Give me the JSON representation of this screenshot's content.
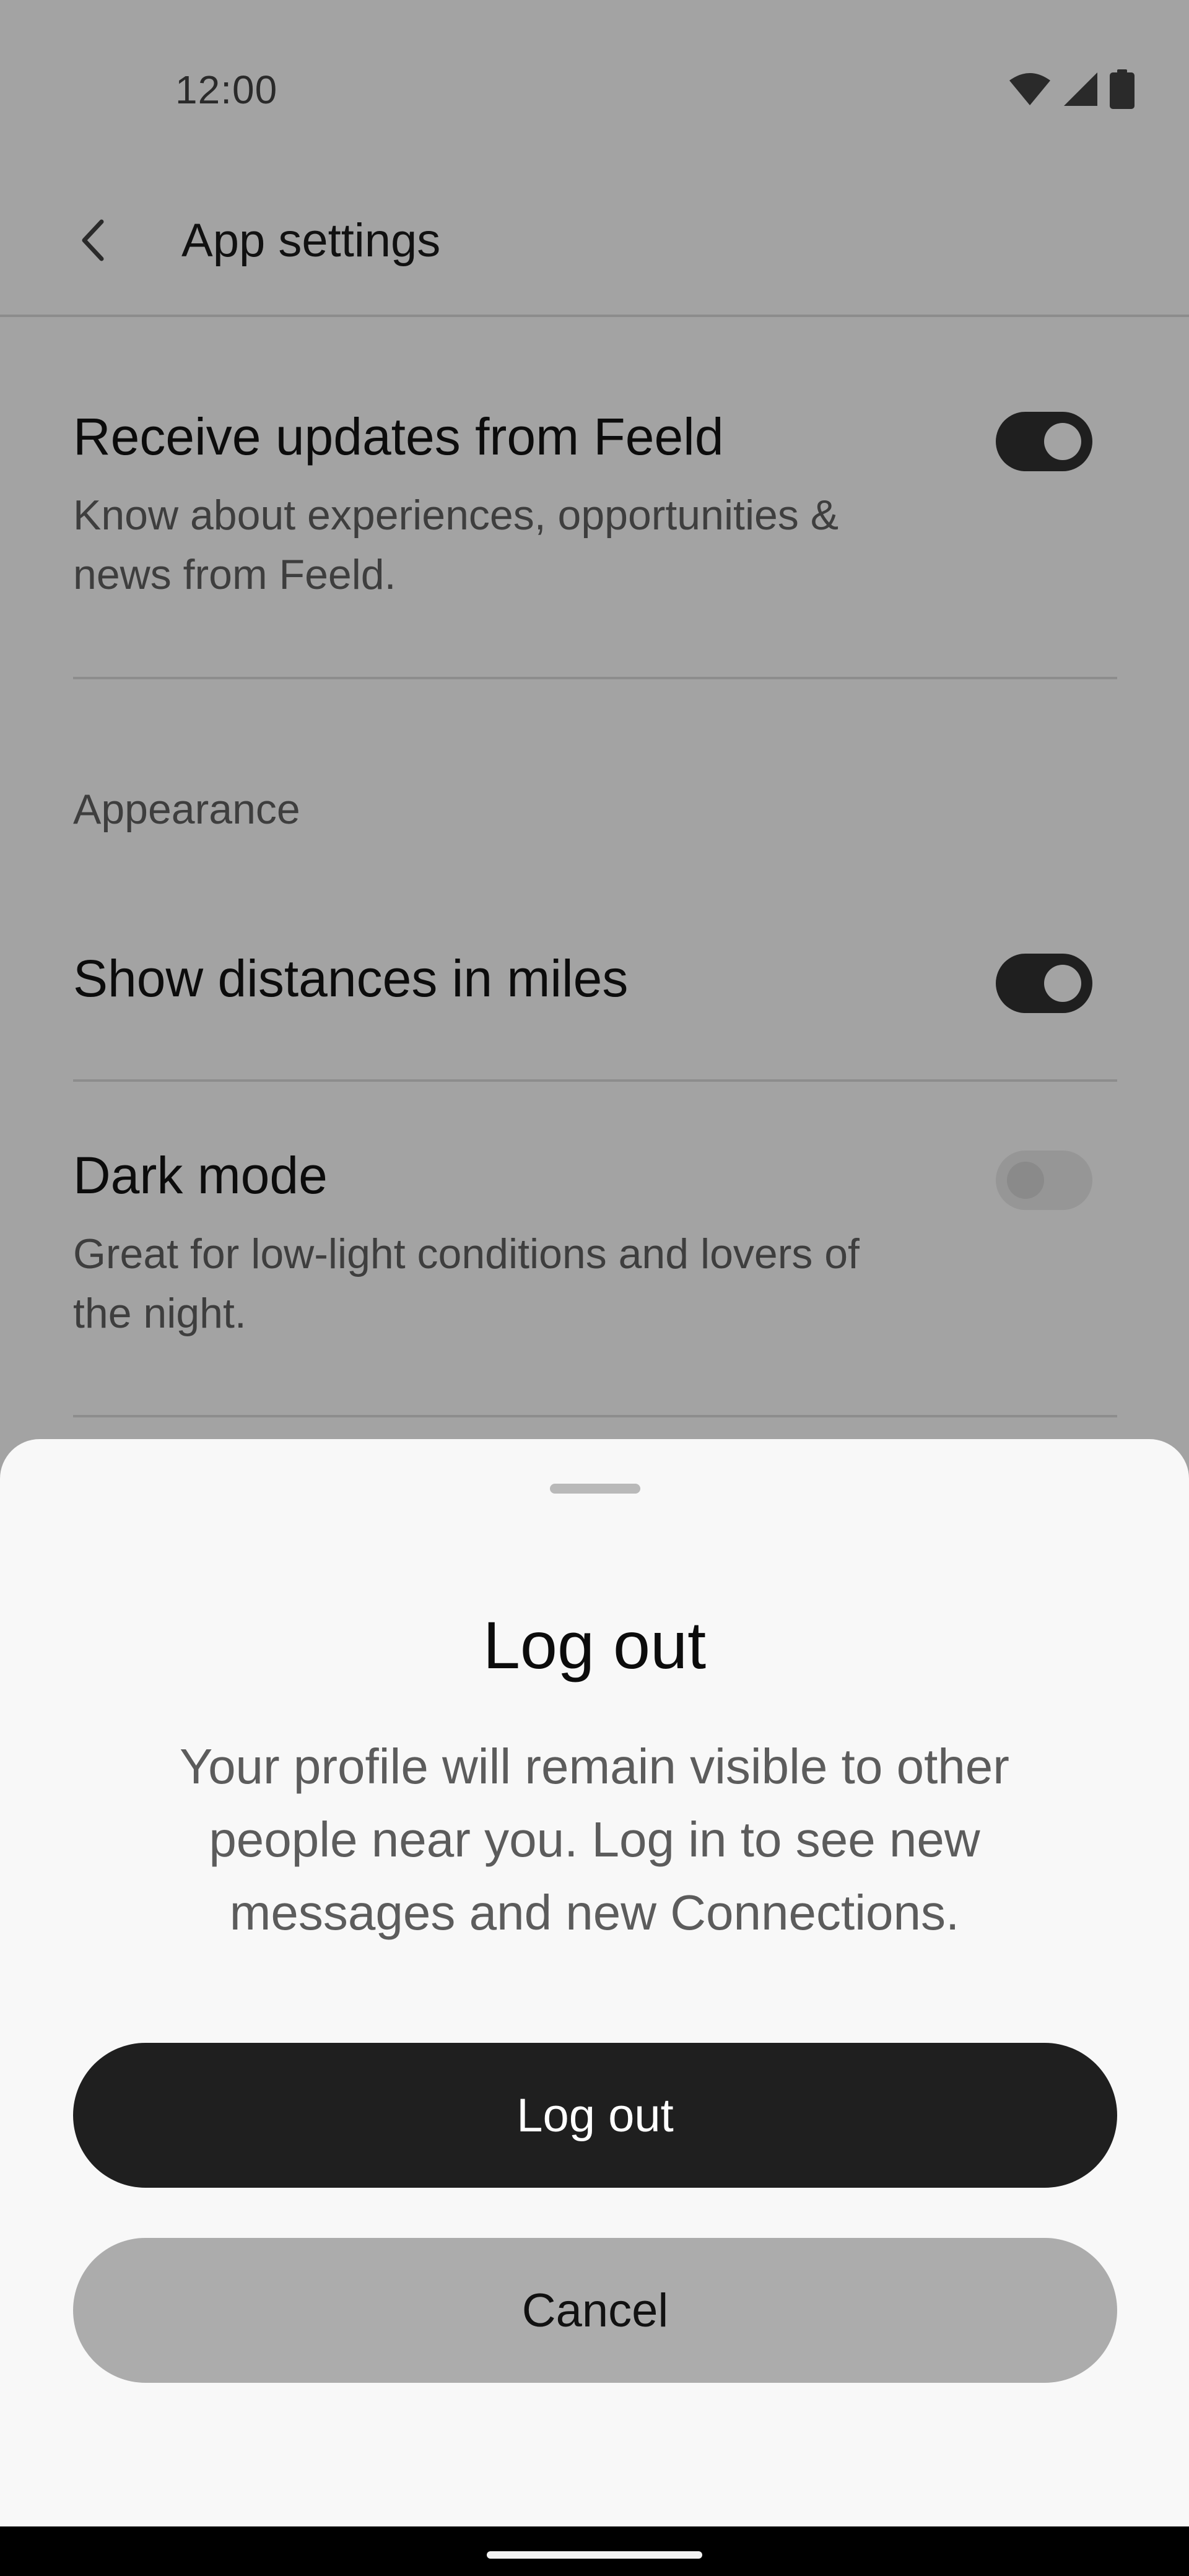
{
  "status_bar": {
    "time": "12:00",
    "icons": [
      "wifi-icon",
      "cellular-signal-icon",
      "battery-icon"
    ]
  },
  "app_bar": {
    "title": "App settings",
    "back_icon": "back-arrow-icon"
  },
  "settings": {
    "receive_updates": {
      "title": "Receive updates from Feeld",
      "description": "Know about experiences, opportunities & news from Feeld.",
      "enabled": true
    },
    "appearance_section_label": "Appearance",
    "show_miles": {
      "title": "Show distances in miles",
      "enabled": true
    },
    "dark_mode": {
      "title": "Dark mode",
      "description": "Great for low-light conditions and lovers of the night.",
      "enabled": false
    }
  },
  "logout_sheet": {
    "title": "Log out",
    "body": "Your profile will remain visible to other people near you. Log in to see new messages and new Connections.",
    "confirm_label": "Log out",
    "cancel_label": "Cancel"
  },
  "colors": {
    "scrim_background": "#a3a3a3",
    "sheet_background": "#f8f8f8",
    "primary_button": "#1f1f1f",
    "secondary_button": "#acacac"
  }
}
